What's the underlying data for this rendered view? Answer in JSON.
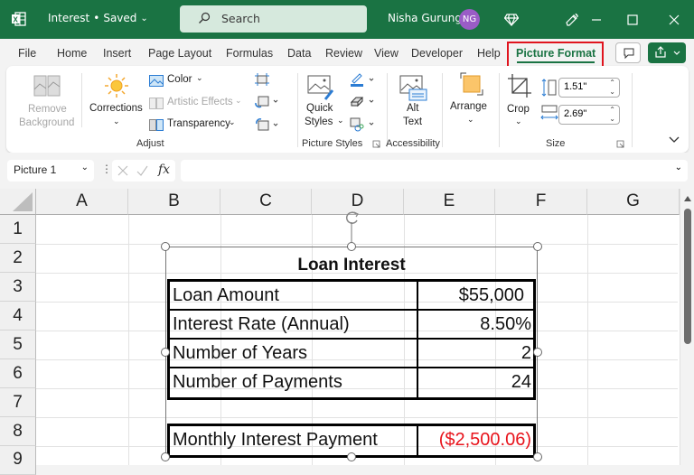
{
  "titlebar": {
    "app_icon": "excel-icon",
    "doc_name": "Interest",
    "doc_status": "Saved",
    "search_placeholder": "Search",
    "user_name": "Nisha Gurung",
    "user_initials": "NG",
    "icons": [
      "premium-diamond-icon",
      "designer-pen-icon",
      "minimize-icon",
      "maximize-icon",
      "close-icon"
    ],
    "accent": "#1a7343"
  },
  "menu": {
    "tabs": [
      "File",
      "Home",
      "Insert",
      "Page Layout",
      "Formulas",
      "Data",
      "Review",
      "View",
      "Developer",
      "Help",
      "Picture Format"
    ],
    "active_tab": "Picture Format",
    "highlight_color": "#e0141e"
  },
  "ribbon": {
    "adjust": {
      "label": "Adjust",
      "remove_background": [
        "Remove",
        "Background"
      ],
      "corrections": "Corrections",
      "color": "Color",
      "artistic_effects": "Artistic Effects",
      "transparency": "Transparency"
    },
    "picture_styles": {
      "label": "Picture Styles",
      "quick_styles": [
        "Quick",
        "Styles"
      ]
    },
    "accessibility": {
      "label": "Accessibility",
      "alt_text": [
        "Alt",
        "Text"
      ]
    },
    "arrange": {
      "label": "Arrange"
    },
    "size": {
      "label": "Size",
      "crop": "Crop",
      "height": "1.51\"",
      "width": "2.69\""
    }
  },
  "formula_bar": {
    "name_box": "Picture 1",
    "formula": ""
  },
  "sheet": {
    "columns": [
      "A",
      "B",
      "C",
      "D",
      "E",
      "F",
      "G"
    ],
    "rows": [
      "1",
      "2",
      "3",
      "4",
      "5",
      "6",
      "7",
      "8",
      "9"
    ]
  },
  "picture": {
    "title": "Loan Interest",
    "rows": [
      {
        "label": "Loan Amount",
        "value": "$55,000"
      },
      {
        "label": "Interest Rate (Annual)",
        "value": "8.50%"
      },
      {
        "label": "Number of Years",
        "value": "2"
      },
      {
        "label": "Number of Payments",
        "value": "24"
      }
    ],
    "result": {
      "label": "Monthly Interest Payment",
      "value": "($2,500.06)",
      "color": "#e8141c"
    }
  }
}
